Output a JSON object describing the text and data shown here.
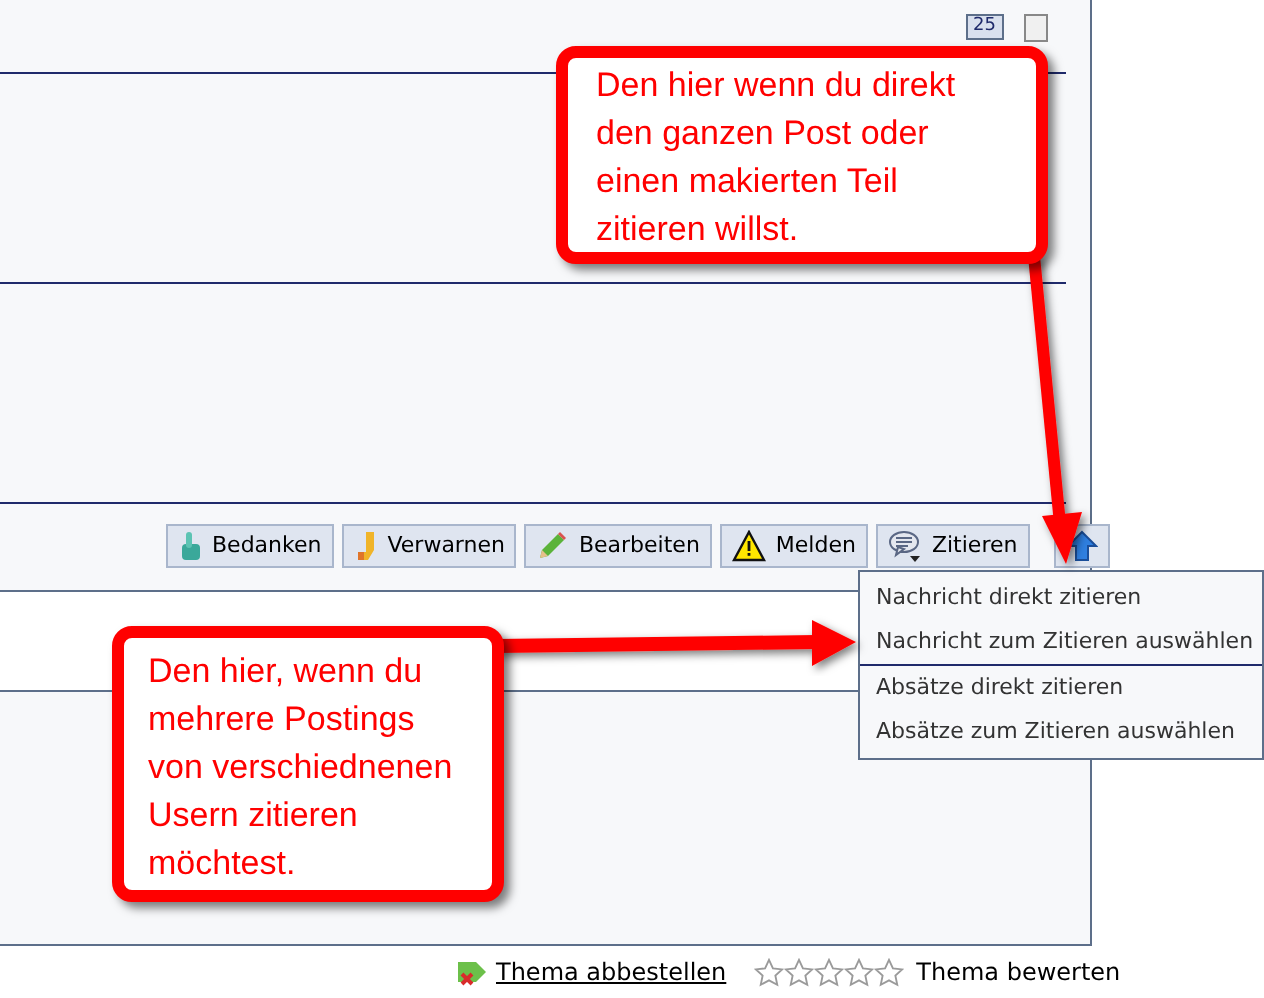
{
  "post_header": {
    "count": "25",
    "checked": false
  },
  "post_actions": [
    {
      "kind": "thumb",
      "label": "Bedanken"
    },
    {
      "kind": "marker",
      "label": "Verwarnen"
    },
    {
      "kind": "pencil",
      "label": "Bearbeiten"
    },
    {
      "kind": "warning",
      "label": "Melden"
    },
    {
      "kind": "quote",
      "label": "Zitieren"
    },
    {
      "kind": "up"
    }
  ],
  "quote_menu": {
    "groups": [
      [
        "Nachricht direkt zitieren",
        "Nachricht zum Zitieren auswählen"
      ],
      [
        "Absätze direkt zitieren",
        "Absätze zum Zitieren auswählen"
      ]
    ]
  },
  "annotations": [
    {
      "text": "Den hier wenn du direkt den ganzen Post oder einen makierten Teil zitieren willst."
    },
    {
      "text": "Den hier, wenn du mehrere Postings von verschiednenen Usern zitieren möchtest."
    }
  ],
  "footer": {
    "unsubscribe": "Thema abbestellen",
    "rating": {
      "stars": 0,
      "label": "Thema bewerten"
    }
  }
}
